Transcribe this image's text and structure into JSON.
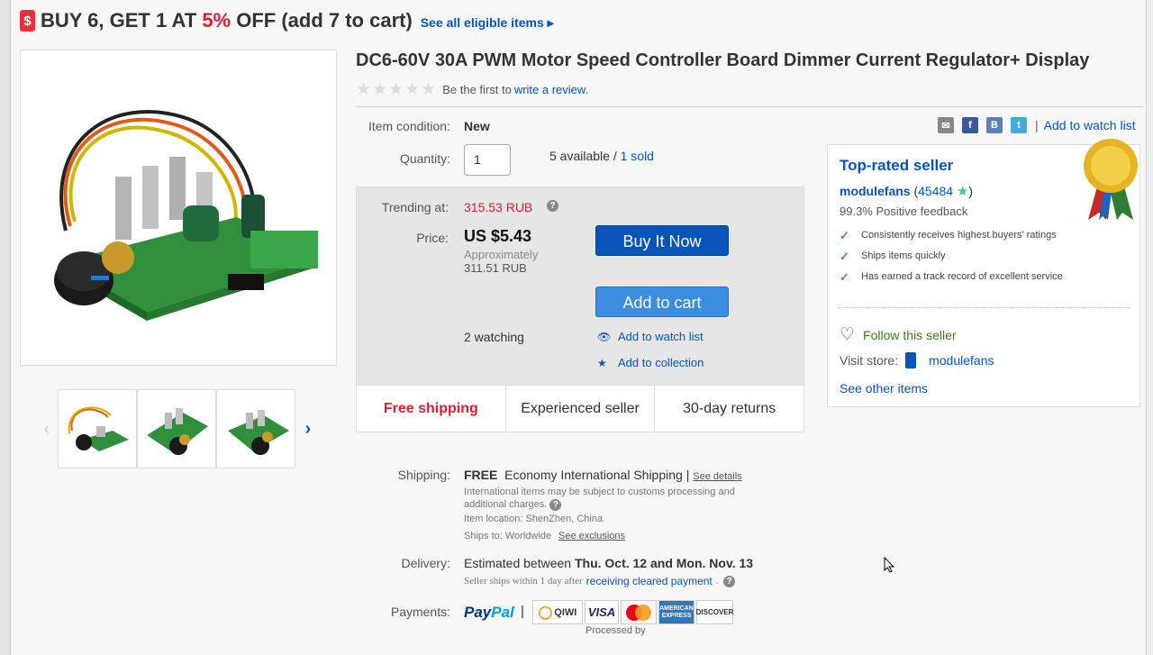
{
  "promo": {
    "tag_icon": "$",
    "text_before": "BUY 6, GET 1 AT ",
    "percent": "5%",
    "text_after": " OFF (add 7 to cart)",
    "eligible_link": "See all eligible items ▸"
  },
  "gallery": {
    "prev_arrow": "‹",
    "next_arrow": "›"
  },
  "listing": {
    "title": "DC6-60V 30A PWM Motor Speed Controller Board Dimmer Current Regulator+ Display",
    "rating_prefix": "Be the first to",
    "review_link": "write a review."
  },
  "item": {
    "condition_label": "Item condition:",
    "condition_value": "New",
    "quantity_label": "Quantity:",
    "quantity_value": "1",
    "available": "5 available / ",
    "sold": "1 sold"
  },
  "buybox": {
    "trending_label": "Trending at:",
    "trending_value": "315.53 RUB",
    "price_label": "Price:",
    "price_value": "US $5.43",
    "approx_label": "Approximately",
    "approx_value": "311.51 RUB",
    "buy_now": "Buy It Now",
    "add_to_cart": "Add to cart",
    "watching": "2 watching",
    "add_watch": "Add to watch list",
    "add_collection": "Add to collection",
    "perks": [
      "Free shipping",
      "Experienced seller",
      "30-day returns"
    ]
  },
  "share": {
    "separator": "|",
    "watch_link": "Add to watch list",
    "icons": [
      "mail-icon",
      "facebook-icon",
      "vk-icon",
      "twitter-icon"
    ]
  },
  "seller": {
    "badge_title": "Top-rated seller",
    "name": "modulefans",
    "feedback_count": "45484",
    "positive": "99.3% Positive feedback",
    "features": [
      "Consistently receives highest buyers' ratings",
      "Ships items quickly",
      "Has earned a track record of excellent service"
    ],
    "follow": "Follow this seller",
    "visit_label": "Visit store:",
    "store_name": "modulefans",
    "other_items": "See other items"
  },
  "shipping": {
    "label": "Shipping:",
    "free": "FREE",
    "method": "Economy International Shipping |",
    "details": "See details",
    "note": "International items may be subject to customs processing and additional charges.",
    "location": "Item location:  ShenZhen, China",
    "ships_to": "Ships to:  Worldwide",
    "exclusions": "See exclusions"
  },
  "delivery": {
    "label": "Delivery:",
    "text": "Estimated between ",
    "dates": "Thu. Oct. 12 and Mon. Nov. 13",
    "note_prefix": "Seller ships within 1 day after",
    "note_link": "receiving cleared payment",
    "note_suffix": "."
  },
  "payments": {
    "label": "Payments:",
    "paypal_a": "Pay",
    "paypal_b": "Pal",
    "separator": "|",
    "qiwi": "QIWI",
    "visa": "VISA",
    "amex": "AMERICAN EXPRESS",
    "discover": "DISCOVER",
    "processed_by": "Processed by"
  },
  "colors": {
    "accent": "#0654ba",
    "promo_red": "#dd1e31",
    "check_green": "#4a9d2f"
  }
}
